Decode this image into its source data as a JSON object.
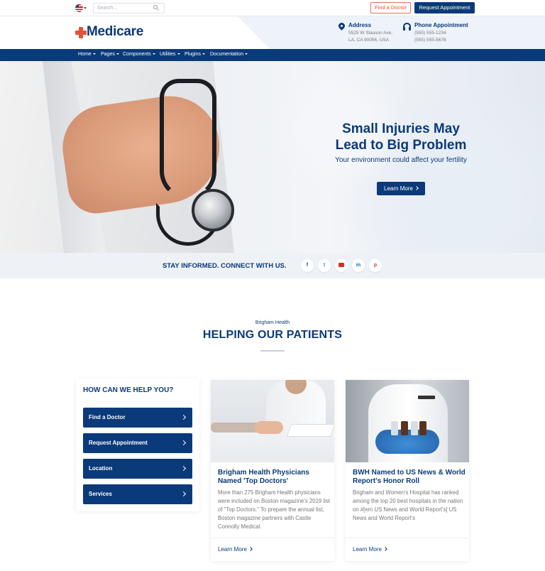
{
  "topbar": {
    "search_placeholder": "Search...",
    "find_doctor": "Find a Doctor",
    "request_appointment": "Request Appointment"
  },
  "header": {
    "logo": "Medicare",
    "address_title": "Address",
    "address_lines": [
      "5525 W Slauson Ave,",
      "LA, CA 90056, USA"
    ],
    "phone_title": "Phone Appointment",
    "phone_lines": [
      "(555) 555-1234",
      "(555) 555-5678"
    ]
  },
  "nav": {
    "items": [
      "Home",
      "Pages",
      "Components",
      "Utilities",
      "Plugins",
      "Documentation"
    ]
  },
  "hero": {
    "title_lines": [
      "Small Injuries May",
      "Lead to Big Problem"
    ],
    "subtitle": "Your environment could affect your fertility",
    "button": "Learn More"
  },
  "social": {
    "title": "STAY INFORMED. CONNECT WITH US.",
    "icons": [
      "facebook-icon",
      "twitter-icon",
      "youtube-icon",
      "linkedin-icon",
      "pinterest-icon"
    ]
  },
  "section": {
    "eyebrow": "Brigham Health",
    "title": "HELPING OUR PATIENTS"
  },
  "help": {
    "title": "HOW CAN WE HELP YOU?",
    "buttons": [
      "Find a Doctor",
      "Request Appointment",
      "Location",
      "Services"
    ]
  },
  "cards": [
    {
      "title": "Brigham Health Physicians Named 'Top Doctors'",
      "text": "More than 275 Brigham Health physicians were included on Boston magazine's 2019 list of \"Top Doctors.\" To prepare the annual list, Boston magazine partners with Castle Connolly Medical.",
      "link": "Learn More"
    },
    {
      "title": "BWH Named to US News & World Report's Honor Roll",
      "text": "Brigham and Women's Hospital has ranked among the top 20 best hospitals in the nation on #[em US News and World Report's] US News and World Report's",
      "link": "Learn More"
    }
  ],
  "colors": {
    "primary": "#0b3a7a",
    "accent": "#e0533a"
  }
}
